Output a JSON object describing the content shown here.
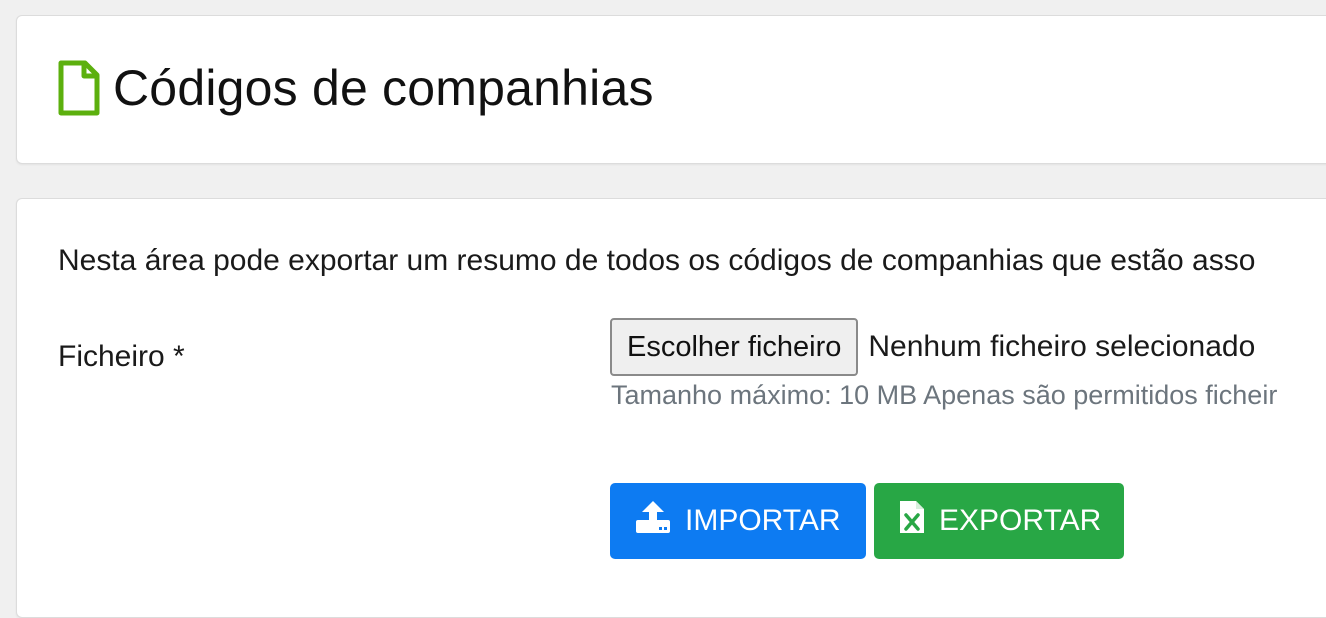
{
  "header": {
    "title": "Códigos de companhias",
    "icon": "file-outline-icon",
    "icon_color": "#5cb00e"
  },
  "main": {
    "intro_text": "Nesta área pode exportar um resumo de todos os códigos de companhias que estão asso",
    "file_field": {
      "label": "Ficheiro *",
      "choose_button_label": "Escolher ficheiro",
      "no_file_text": "Nenhum ficheiro selecionado",
      "help_text": "Tamanho máximo: 10 MB Apenas são permitidos ficheir"
    },
    "actions": {
      "import_label": "IMPORTAR",
      "import_icon": "upload-icon",
      "import_color": "#0d7bf2",
      "export_label": "EXPORTAR",
      "export_icon": "excel-file-icon",
      "export_color": "#28a745"
    }
  }
}
